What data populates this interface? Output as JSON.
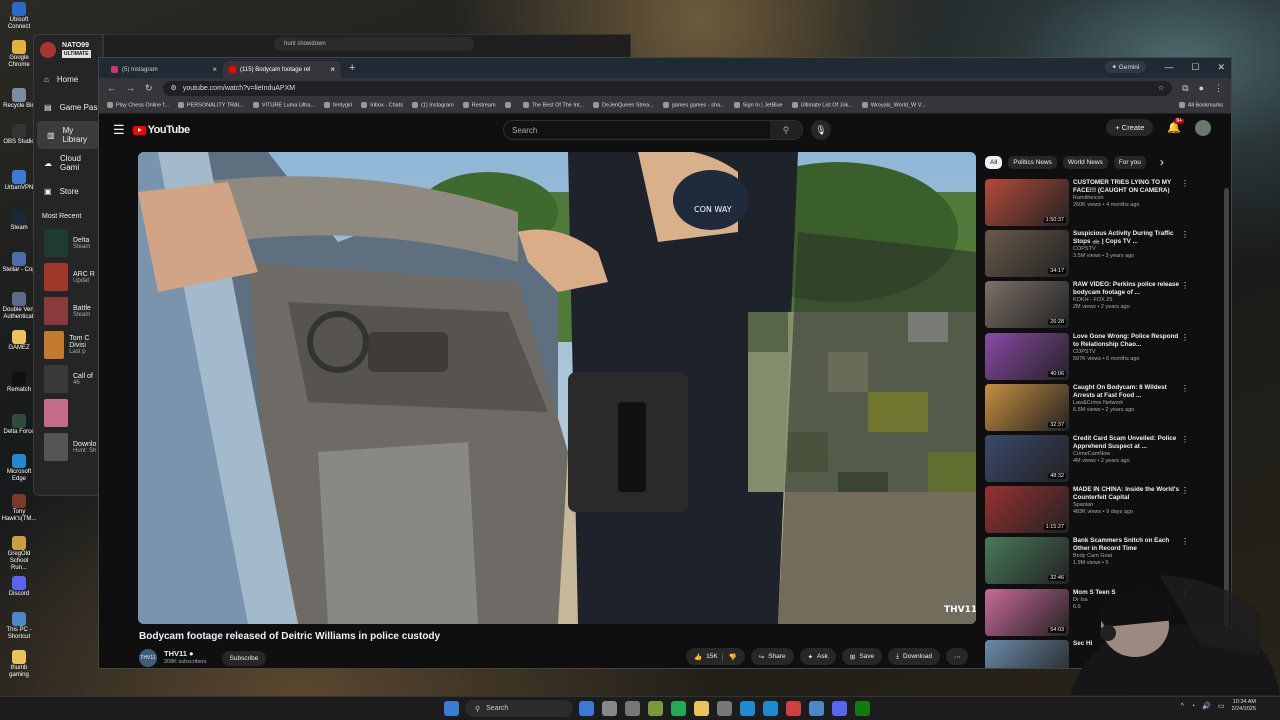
{
  "desktop": {
    "icons": [
      {
        "label": "Ubisoft Connect",
        "color": "#2a6acb"
      },
      {
        "label": "Google Chrome",
        "color": "#e2b33c"
      },
      {
        "label": "Recycle Bin",
        "color": "#7a8ea0"
      },
      {
        "label": "OBS Studio",
        "color": "#333333"
      },
      {
        "label": "UrbanVPN",
        "color": "#3a7bd5"
      },
      {
        "label": "Steam",
        "color": "#1b2838"
      },
      {
        "label": "Stellar - Cop",
        "color": "#4b6ea8"
      },
      {
        "label": "Double Verti Authenticati",
        "color": "#5a6c8a"
      },
      {
        "label": "GAMEZ",
        "color": "#e8c45a"
      },
      {
        "label": "Rematch",
        "color": "#111111"
      },
      {
        "label": "Delta Force",
        "color": "#2d4d3a"
      },
      {
        "label": "Microsoft Edge",
        "color": "#1f8ad2"
      },
      {
        "label": "Tony Hawk's(TM...",
        "color": "#7a3a2a"
      },
      {
        "label": "GregOld School Run...",
        "color": "#c8a040"
      },
      {
        "label": "Discord",
        "color": "#5865f2"
      },
      {
        "label": "This PC - Shortcut",
        "color": "#4a88c8"
      },
      {
        "label": "thumb gaming",
        "color": "#e8c45a"
      }
    ]
  },
  "xbox": {
    "gamertag": "NATO99",
    "badge": "ULTIMATE",
    "nav": [
      {
        "label": "Home",
        "icon": "home-icon",
        "glyph": "⌂"
      },
      {
        "label": "Game Pass",
        "icon": "game-pass-icon",
        "glyph": "▤"
      },
      {
        "label": "My Library",
        "icon": "library-icon",
        "glyph": "▥"
      },
      {
        "label": "Cloud Gami",
        "icon": "cloud-icon",
        "glyph": "☁"
      },
      {
        "label": "Store",
        "icon": "store-icon",
        "glyph": "▣"
      }
    ],
    "section": "Most Recent",
    "recent": [
      {
        "title": "Delta",
        "sub": "Steam",
        "color": "#1e3a32"
      },
      {
        "title": "ARC R",
        "sub": "Updat",
        "color": "#a0382c"
      },
      {
        "title": "Battle",
        "sub": "Steam",
        "color": "#8a3a3a"
      },
      {
        "title": "Tom C Divisi",
        "sub": "Last p",
        "color": "#c27a2c"
      },
      {
        "title": "Call of",
        "sub": "46",
        "color": "#3a3a3a"
      },
      {
        "title": "",
        "sub": "",
        "color": "#c46a8a"
      },
      {
        "title": "Downlo",
        "sub": "Hunt: Sh",
        "color": "#555555"
      }
    ]
  },
  "bg_window": {
    "search_text": "hunt showdown"
  },
  "browser": {
    "tabs": [
      {
        "label": "(5) Instagram",
        "color": "#d6336c",
        "active": false
      },
      {
        "label": "(115) Bodycam footage rel",
        "color": "#ff0000",
        "active": true
      }
    ],
    "new_tab": "+",
    "gemini": "Gemini",
    "url": "youtube.com/watch?v=lieInduAPXM",
    "bookmarks": [
      "Play Chess Online f...",
      "PERSONALITY TRAI...",
      "VITURE Luma Ultra...",
      "fentygirl",
      "Inbox - Chats",
      "(1) Instagram",
      "Restream",
      "",
      "The Best Of The Int...",
      "DeJenQueen Strea...",
      "games games - sha...",
      "Sign In | JetBlue",
      "Ultimate List Of Jok...",
      "Wroyals_World_W V..."
    ],
    "all_bookmarks": "All Bookmarks"
  },
  "youtube": {
    "logo": "YouTube",
    "search_placeholder": "Search",
    "create": "Create",
    "notif_count": "9+",
    "video_title": "Bodycam footage released of Deitric Williams in police custody",
    "channel": {
      "name": "THV11",
      "subscribers": "208K subscribers",
      "avatar_text": "THV11"
    },
    "subscribe": "Subscribe",
    "actions": {
      "likes": "15K",
      "share": "Share",
      "ask": "Ask",
      "save": "Save",
      "download": "Download"
    },
    "watermark": "THV11",
    "patch_text": "CON WAY",
    "chips": [
      "All",
      "Politics News",
      "World News",
      "For you"
    ],
    "recs": [
      {
        "title": "CUSTOMER TRIES LYING TO MY FACE!!! (CAUGHT ON CAMERA)",
        "channel": "Ramitheicon",
        "meta": "260K views • 4 months ago",
        "duration": "1:50:37",
        "color": "#b54a3a"
      },
      {
        "title": "Suspicious Activity During Traffic Stops 🚓 | Cops TV ...",
        "channel": "COPSTV",
        "meta": "3.5M views • 3 years ago",
        "duration": "34:17",
        "color": "#6a5a4a"
      },
      {
        "title": "RAW VIDEO: Perkins police release bodycam footage of ...",
        "channel": "KOKH - FOX 25",
        "meta": "2M views • 2 years ago",
        "duration": "26:28",
        "color": "#7a7068"
      },
      {
        "title": "Love Gone Wrong: Police Respond to Relationship Chao...",
        "channel": "COPSTV",
        "meta": "597K views • 6 months ago",
        "duration": "40:06",
        "color": "#8a4aa8"
      },
      {
        "title": "Caught On Bodycam: 8 Wildest Arrests at Fast Food ...",
        "channel": "Law&Crime Network",
        "meta": "6.5M views • 2 years ago",
        "duration": "32:37",
        "color": "#c89040"
      },
      {
        "title": "Credit Card Scam Unveiled: Police Apprehend Suspect at ...",
        "channel": "CrimeCamNow",
        "meta": "4M views • 2 years ago",
        "duration": "48:32",
        "color": "#3a4a6a"
      },
      {
        "title": "MADE IN CHINA: Inside the World's Counterfeit Capital",
        "channel": "Spanlan",
        "meta": "483K views • 9 days ago",
        "duration": "1:15:27",
        "color": "#9a3030"
      },
      {
        "title": "Bank Scammers Snitch on Each Other in Record Time",
        "channel": "Body Cam Goat",
        "meta": "1.9M views • 5",
        "duration": "32:46",
        "color": "#4a7a5a"
      },
      {
        "title": "Mom S Teen S",
        "channel": "Dr Isa",
        "meta": "6.6",
        "duration": "54:03",
        "color": "#c86a9a"
      },
      {
        "title": "Sec Hi",
        "channel": "",
        "meta": "",
        "duration": "",
        "color": "#6a8aa8"
      }
    ]
  },
  "taskbar": {
    "search": "Search",
    "time": "10:34 AM",
    "date": "2/24/2025",
    "apps": [
      "#3a7bd5",
      "#888888",
      "#777777",
      "#7a9a3a",
      "#22aa55",
      "#e8c45a",
      "#777777",
      "#1f8ad2",
      "#1f8ad2",
      "#d04040",
      "#4a88c8",
      "#5865f2",
      "#107c10"
    ]
  }
}
